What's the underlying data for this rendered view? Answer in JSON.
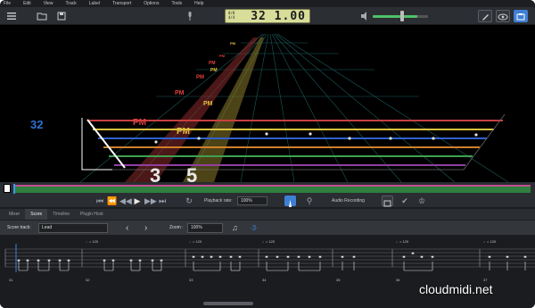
{
  "menu": [
    "File",
    "Edit",
    "View",
    "Track",
    "Label",
    "Transport",
    "Options",
    "Tools",
    "Help"
  ],
  "toolbar": {
    "lcd_top": "8/8",
    "lcd_bottom": "4/4",
    "position": "32 1.00",
    "accent_color": "#3e7fd3"
  },
  "highway": {
    "measure_number": "32",
    "fret_labels": [
      "3",
      "5"
    ],
    "pm_label": "PM"
  },
  "transport": {
    "playback_rate_label": "Playback rate:",
    "playback_rate_value": "100%",
    "audio_recording_label": "Audio Recording"
  },
  "tabs": [
    "Mixer",
    "Score",
    "Timeline",
    "Plugin Host"
  ],
  "score_toolbar": {
    "score_track_label": "Score track:",
    "score_track_value": "Lead",
    "zoom_label": "Zoom :",
    "zoom_value": "100%"
  },
  "score": {
    "tempo_mark": "♩= 120",
    "bar_numbers": [
      "31",
      "32",
      "33",
      "34",
      "35",
      "36",
      "37"
    ]
  },
  "watermark": "cloudmidi.net"
}
